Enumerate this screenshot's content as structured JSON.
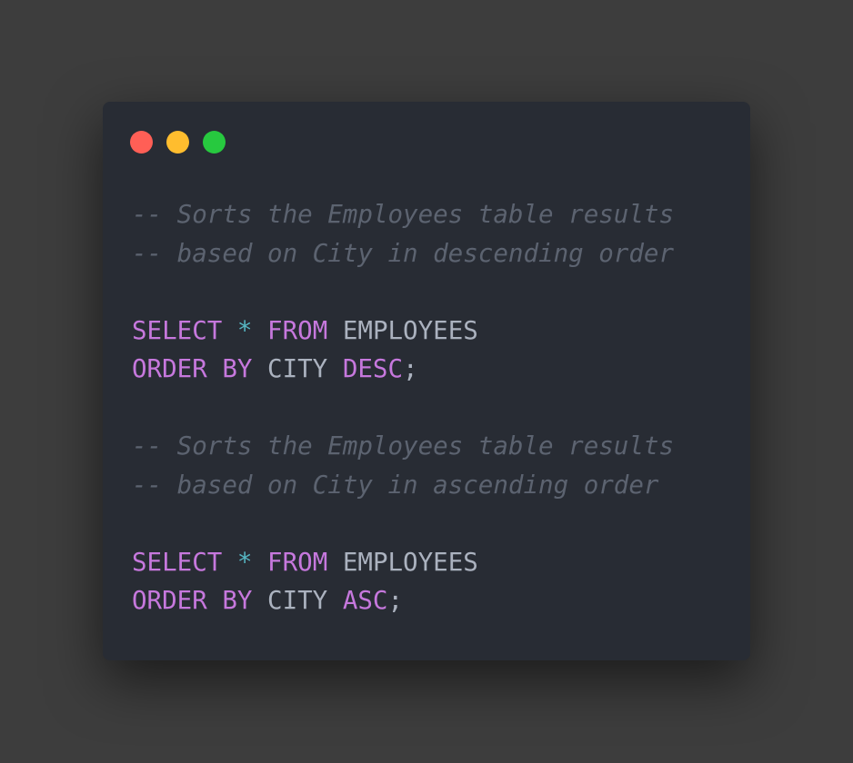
{
  "window": {
    "traffic_lights": [
      {
        "name": "close",
        "color": "#ff5f56"
      },
      {
        "name": "minimize",
        "color": "#ffbd2e"
      },
      {
        "name": "maximize",
        "color": "#27c93f"
      }
    ]
  },
  "colors": {
    "keyword": "#c678dd",
    "operator": "#56b6c2",
    "identifier": "#abb2bf",
    "comment": "#5c6370"
  },
  "code": {
    "lines": [
      {
        "tokens": [
          {
            "t": "comment",
            "text": "-- Sorts the Employees table results"
          }
        ]
      },
      {
        "tokens": [
          {
            "t": "comment",
            "text": "-- based on City in descending order"
          }
        ]
      },
      {
        "tokens": []
      },
      {
        "tokens": [
          {
            "t": "keyword",
            "text": "SELECT"
          },
          {
            "t": "plain",
            "text": " "
          },
          {
            "t": "operator",
            "text": "*"
          },
          {
            "t": "plain",
            "text": " "
          },
          {
            "t": "keyword",
            "text": "FROM"
          },
          {
            "t": "plain",
            "text": " "
          },
          {
            "t": "identifier",
            "text": "EMPLOYEES"
          }
        ]
      },
      {
        "tokens": [
          {
            "t": "keyword",
            "text": "ORDER BY"
          },
          {
            "t": "plain",
            "text": " "
          },
          {
            "t": "identifier",
            "text": "CITY"
          },
          {
            "t": "plain",
            "text": " "
          },
          {
            "t": "keyword",
            "text": "DESC"
          },
          {
            "t": "identifier",
            "text": ";"
          }
        ]
      },
      {
        "tokens": []
      },
      {
        "tokens": [
          {
            "t": "comment",
            "text": "-- Sorts the Employees table results"
          }
        ]
      },
      {
        "tokens": [
          {
            "t": "comment",
            "text": "-- based on City in ascending order"
          }
        ]
      },
      {
        "tokens": []
      },
      {
        "tokens": [
          {
            "t": "keyword",
            "text": "SELECT"
          },
          {
            "t": "plain",
            "text": " "
          },
          {
            "t": "operator",
            "text": "*"
          },
          {
            "t": "plain",
            "text": " "
          },
          {
            "t": "keyword",
            "text": "FROM"
          },
          {
            "t": "plain",
            "text": " "
          },
          {
            "t": "identifier",
            "text": "EMPLOYEES"
          }
        ]
      },
      {
        "tokens": [
          {
            "t": "keyword",
            "text": "ORDER BY"
          },
          {
            "t": "plain",
            "text": " "
          },
          {
            "t": "identifier",
            "text": "CITY"
          },
          {
            "t": "plain",
            "text": " "
          },
          {
            "t": "keyword",
            "text": "ASC"
          },
          {
            "t": "identifier",
            "text": ";"
          }
        ]
      }
    ]
  }
}
